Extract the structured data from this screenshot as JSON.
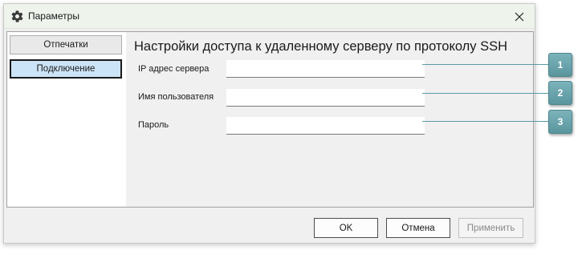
{
  "window": {
    "title": "Параметры",
    "icon": "gear-icon",
    "close_icon": "close-icon"
  },
  "nav": {
    "items": [
      {
        "label": "Отпечатки",
        "active": false
      },
      {
        "label": "Подключение",
        "active": true
      }
    ]
  },
  "content": {
    "heading": "Настройки доступа к удаленному серверу по протоколу SSH",
    "fields": [
      {
        "label": "IP адрес сервера",
        "value": ""
      },
      {
        "label": "Имя пользователя",
        "value": ""
      },
      {
        "label": "Пароль",
        "value": ""
      }
    ]
  },
  "buttons": {
    "ok": "OK",
    "cancel": "Отмена",
    "apply": "Применить"
  },
  "callouts": [
    "1",
    "2",
    "3"
  ],
  "colors": {
    "accent": "#cce4f7",
    "callout": "#6aa5ad",
    "titlebar": "#eef4ec"
  }
}
